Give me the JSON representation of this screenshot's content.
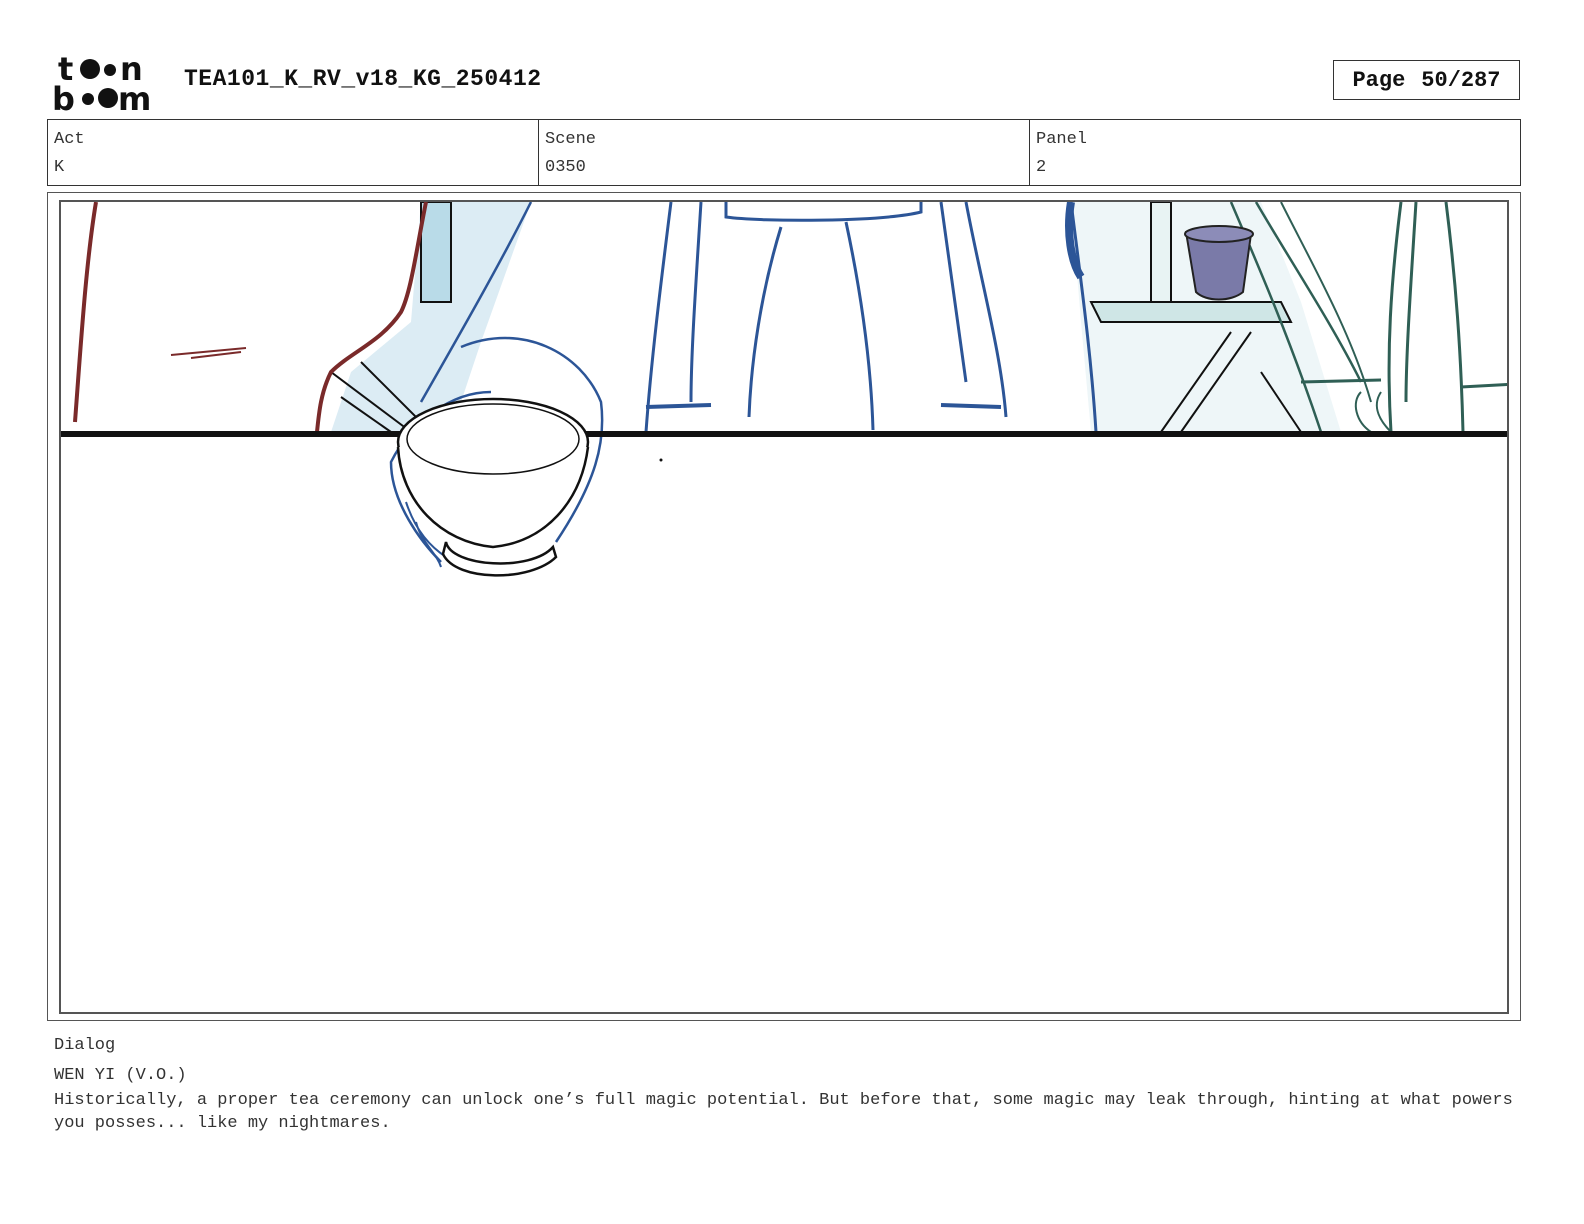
{
  "header": {
    "logo_text": "toon boom",
    "doc_title": "TEA101_K_RV_v18_KG_250412",
    "page_label": "Page",
    "page_value": "50/287"
  },
  "info": {
    "act_label": "Act",
    "act_value": "K",
    "scene_label": "Scene",
    "scene_value": "0350",
    "panel_label": "Panel",
    "panel_value": "2"
  },
  "panel_image": {
    "description_icon": "storyboard-sketch-image"
  },
  "dialog": {
    "label": "Dialog",
    "speaker": "WEN YI (V.O.)",
    "text": "Historically, a proper tea ceremony can unlock one’s full magic potential. But before that, some magic may leak through, hinting at what powers you posses... like my nightmares."
  },
  "colors": {
    "red_line": "#7a2a2a",
    "blue_line": "#2c5597",
    "green_line": "#2f5f55",
    "pot": "#7a7aa8",
    "wall": "#d8ecf2"
  }
}
